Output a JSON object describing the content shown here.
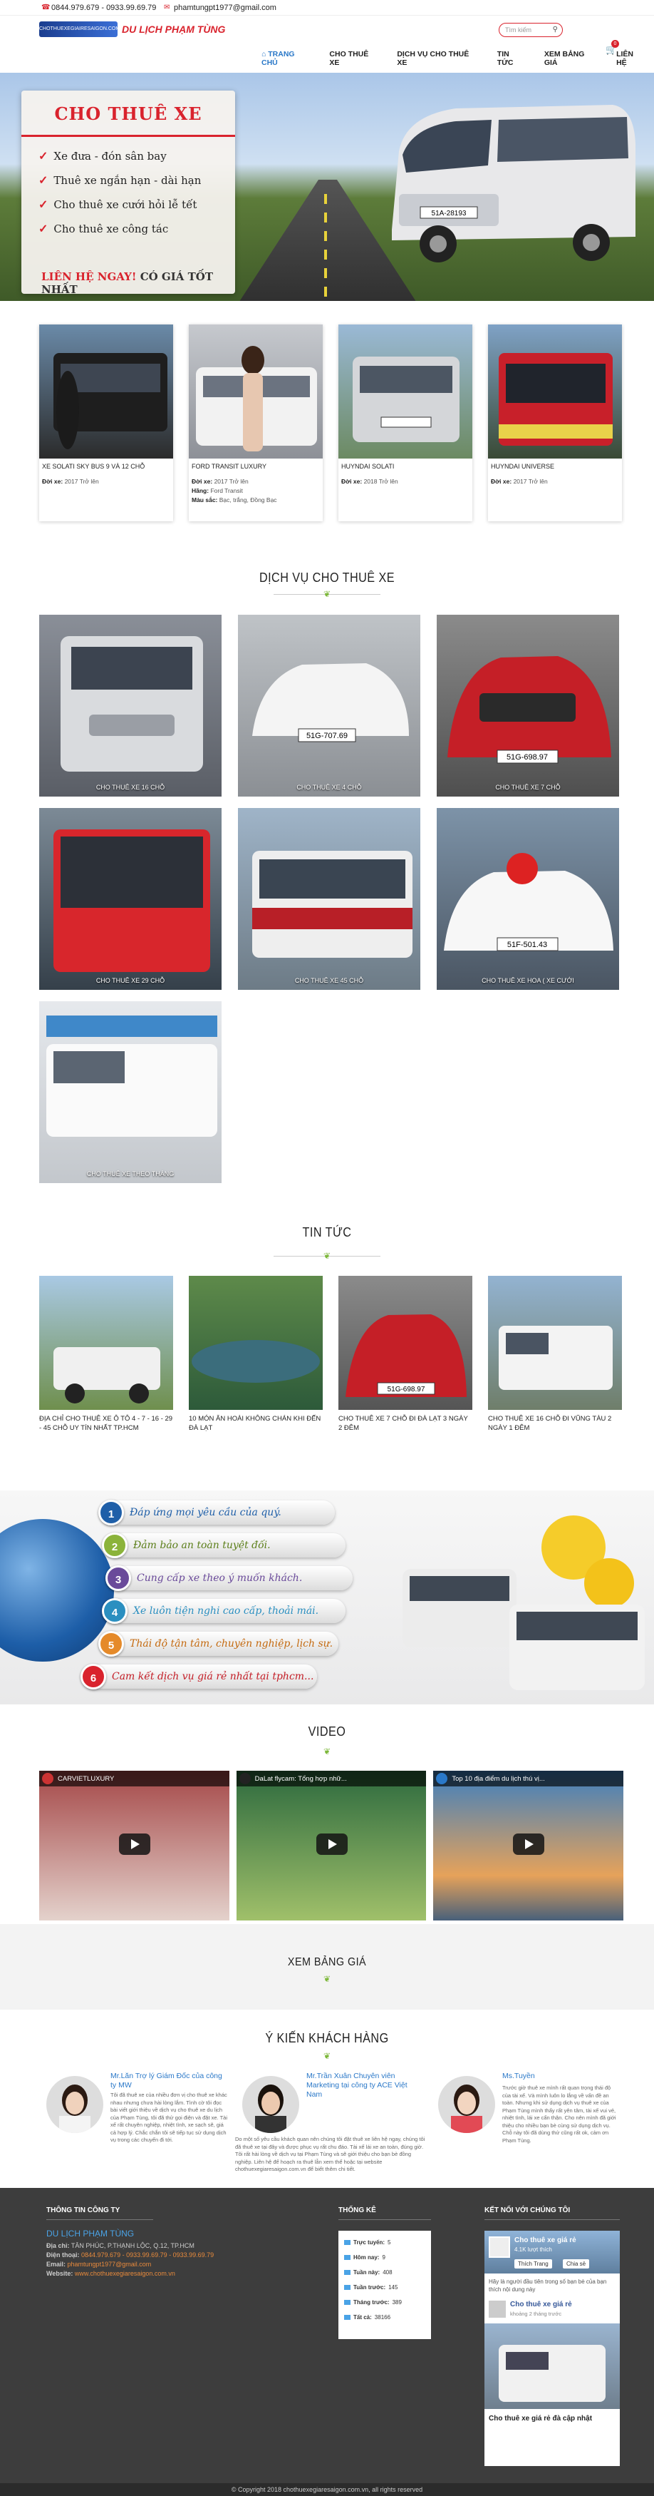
{
  "topbar": {
    "phone": "0844.979.679 - 0933.99.69.79",
    "email": "phamtungpt1977@gmail.com"
  },
  "header": {
    "logo_mark": "CHOTHUEXEGIAIRESAIGON.COM.VN",
    "logo_name": "DU LỊCH PHẠM TÙNG",
    "search_placeholder": "Tìm kiếm",
    "cart_count": "0",
    "nav": [
      "TRANG CHỦ",
      "CHO THUÊ XE",
      "DỊCH VỤ CHO THUÊ XE",
      "TIN TỨC",
      "XEM BẢNG GIÁ",
      "LIÊN HỆ"
    ]
  },
  "hero": {
    "title": "CHO THUÊ XE",
    "items": [
      "Xe đưa - đón sân bay",
      "Thuê xe ngắn hạn - dài hạn",
      "Cho thuê xe cưới hỏi lễ tết",
      "Cho thuê xe công tác"
    ],
    "cta_red": "LIÊN HỆ NGAY!",
    "cta_dark": "CÓ GIÁ TỐT NHẤT",
    "plate": "51A-28193"
  },
  "products": [
    {
      "title": "XE SOLATI SKY BUS 9 VÀ 12 CHỖ",
      "lines": [],
      "label_year": "",
      "year": ""
    },
    {
      "title": "FORD TRANSIT LUXURY",
      "label_year": "Đời xe:",
      "year": "2017 Trở lên",
      "lines": [
        {
          "k": "Hãng:",
          "v": "Ford Transit"
        },
        {
          "k": "Màu sắc:",
          "v": "Bạc, trắng, Đồng Bạc"
        }
      ]
    },
    {
      "title": "HUYNDAI SOLATI",
      "label_year": "Đời xe:",
      "year": "2018 Trở lên",
      "lines": []
    },
    {
      "title": "HUYNDAI UNIVERSE",
      "label_year": "Đời xe:",
      "year": "2017 Trở lên",
      "lines": []
    }
  ],
  "product0_year_label": "Đời xe:",
  "product0_year": "2017 Trở lên",
  "services_title": "DỊCH VỤ CHO THUÊ XE",
  "services": [
    {
      "label": "CHO THUÊ XE 16 CHỖ",
      "plate": ""
    },
    {
      "label": "CHO THUÊ XE 4 CHỖ",
      "plate": "51G-707.69"
    },
    {
      "label": "CHO THUÊ XE 7 CHỖ",
      "plate": "51G-698.97"
    },
    {
      "label": "CHO THUÊ XE 29 CHỖ",
      "plate": ""
    },
    {
      "label": "CHO THUÊ XE 45 CHỖ",
      "plate": ""
    },
    {
      "label": "CHO THUÊ XE HOA ( XE CƯỚI",
      "plate": "51F-501.43"
    },
    {
      "label": "CHO THUÊ XE THEO THÁNG",
      "plate": ""
    }
  ],
  "news_title": "TIN TỨC",
  "news": [
    "ĐỊA CHỈ CHO THUÊ XE Ô TÔ 4 - 7 - 16 - 29 - 45 CHỖ UY TÍN NHẤT TP.HCM",
    "10 MÓN ĂN HOÀI KHÔNG CHÁN KHI ĐẾN ĐÀ LẠT",
    "CHO THUÊ XE 7 CHỖ ĐI ĐÀ LẠT 3 NGÀY 2 ĐÊM",
    "CHO THUÊ XE 16 CHỖ ĐI VŨNG TÀU 2 NGÀY 1 ĐÊM"
  ],
  "news_plate": "51G-698.97",
  "benefits": [
    {
      "n": "1",
      "text": "Đáp ứng mọi yêu cầu của quý.",
      "color": "#1f5fa8"
    },
    {
      "n": "2",
      "text": "Đảm bảo an toàn tuyệt đối.",
      "color": "#8bb33a"
    },
    {
      "n": "3",
      "text": "Cung cấp xe theo ý muốn khách.",
      "color": "#6a4a9a"
    },
    {
      "n": "4",
      "text": "Xe luôn tiện nghi cao cấp, thoải mái.",
      "color": "#2b8fc0"
    },
    {
      "n": "5",
      "text": "Thái độ tận tâm, chuyên nghiệp, lịch sự.",
      "color": "#e58a2a"
    },
    {
      "n": "6",
      "text": "Cam kết dịch vụ giá rẻ nhất tại tphcm...",
      "color": "#d9232d"
    }
  ],
  "video_title": "VIDEO",
  "videos": [
    "CARVIETLUXURY",
    "DaLat flycam: Tổng hợp nhữ...",
    "Top 10 địa điểm du lịch thú vị..."
  ],
  "pricing_title": "XEM BẢNG GIÁ",
  "testimonials_title": "Ý KIẾN KHÁCH HÀNG",
  "testimonials": [
    {
      "name": "Mr.Lăn Trợ lý Giám Đốc của công ty MW",
      "text": "Tôi đã thuê xe của nhiều đơn vị cho thuê xe khác nhau nhưng chưa hài lòng lắm. Tình cờ tôi đọc bài viết giới thiệu về dịch vụ cho thuê xe du lịch của Phạm Tùng, tôi đã thử gọi điện và đặt xe. Tài xế rất chuyên nghiệp, nhiệt tình, xe sạch sẽ, giá cả hợp lý. Chắc chắn tôi sẽ tiếp tục sử dụng dịch vụ trong các chuyến đi tới."
    },
    {
      "name": "Mr.Trần Xuân Chuyên viên Marketing tại công ty ACE Việt Nam",
      "text": "Do một số yêu cầu khách quan nên chúng tôi đặt thuê xe liên hệ ngay, chúng tôi đã thuê xe tại đây và được phục vụ rất chu đáo. Tài xế lái xe an toàn, đúng giờ. Tôi rất hài lòng về dịch vụ tại Phạm Tùng và sẽ giới thiệu cho bạn bè đồng nghiệp. Liên hệ để hoạch ra thuê lẫn xem thể hoặc tại website chothuexegiaresaigon.com.vn để biết thêm chi tiết."
    },
    {
      "name": "Ms.Tuyền",
      "text": "Trước giờ thuê xe mình rất quan trọng thái độ của tài xế. Và mình luôn lo lắng về vấn đề an toàn. Nhưng khi sử dụng dịch vụ thuê xe của Phạm Tùng mình thấy rất yên tâm, tài xế vui vẻ, nhiệt tình, lái xe cẩn thận. Cho nên mình đã giới thiệu cho nhiều bạn bè cùng sử dụng dịch vụ. Chỗ này tôi đã dùng thử cũng rất ok, cảm ơn Phạm Tùng."
    }
  ],
  "footer": {
    "info_title": "THÔNG TIN CÔNG TY",
    "company": "DU LỊCH PHẠM TÙNG",
    "address_label": "Địa chỉ:",
    "address": "TÂN PHÚC, P.THẠNH LỘC, Q.12, TP.HCM",
    "phone_label": "Điện thoại:",
    "phone": "0844.979.679 - 0933.99.69.79 - 0933.99.69.79",
    "email_label": "Email:",
    "email": "phamtungpt1977@gmail.com",
    "web_label": "Website:",
    "web": "www.chothuexegiaresaigon.com.vn",
    "stats_title": "THỐNG KÊ",
    "stats": [
      {
        "k": "Trực tuyến:",
        "v": "5"
      },
      {
        "k": "Hôm nay:",
        "v": "9"
      },
      {
        "k": "Tuần này:",
        "v": "408"
      },
      {
        "k": "Tuần trước:",
        "v": "145"
      },
      {
        "k": "Tháng trước:",
        "v": "389"
      },
      {
        "k": "Tất cả:",
        "v": "38166"
      }
    ],
    "connect_title": "KẾT NỐI VỚI CHÚNG TÔI",
    "fb_page": "Cho thuê xe giá rẻ",
    "fb_likes": "4.1K lượt thích",
    "fb_like_btn": "Thích Trang",
    "fb_share": "Chia sẻ",
    "fb_text": "Hãy là người đầu tiên trong số bạn bè của bạn thích nội dung này",
    "fb_post_title": "Cho thuê xe giá rẻ",
    "fb_post_time": "khoảng 2 tháng trước",
    "fb_post_caption": "Cho thuê xe giá rẻ đà cập nhật"
  },
  "copyright": "© Copyright 2018 chothuexegiaresaigon.com.vn, all rights reserved"
}
